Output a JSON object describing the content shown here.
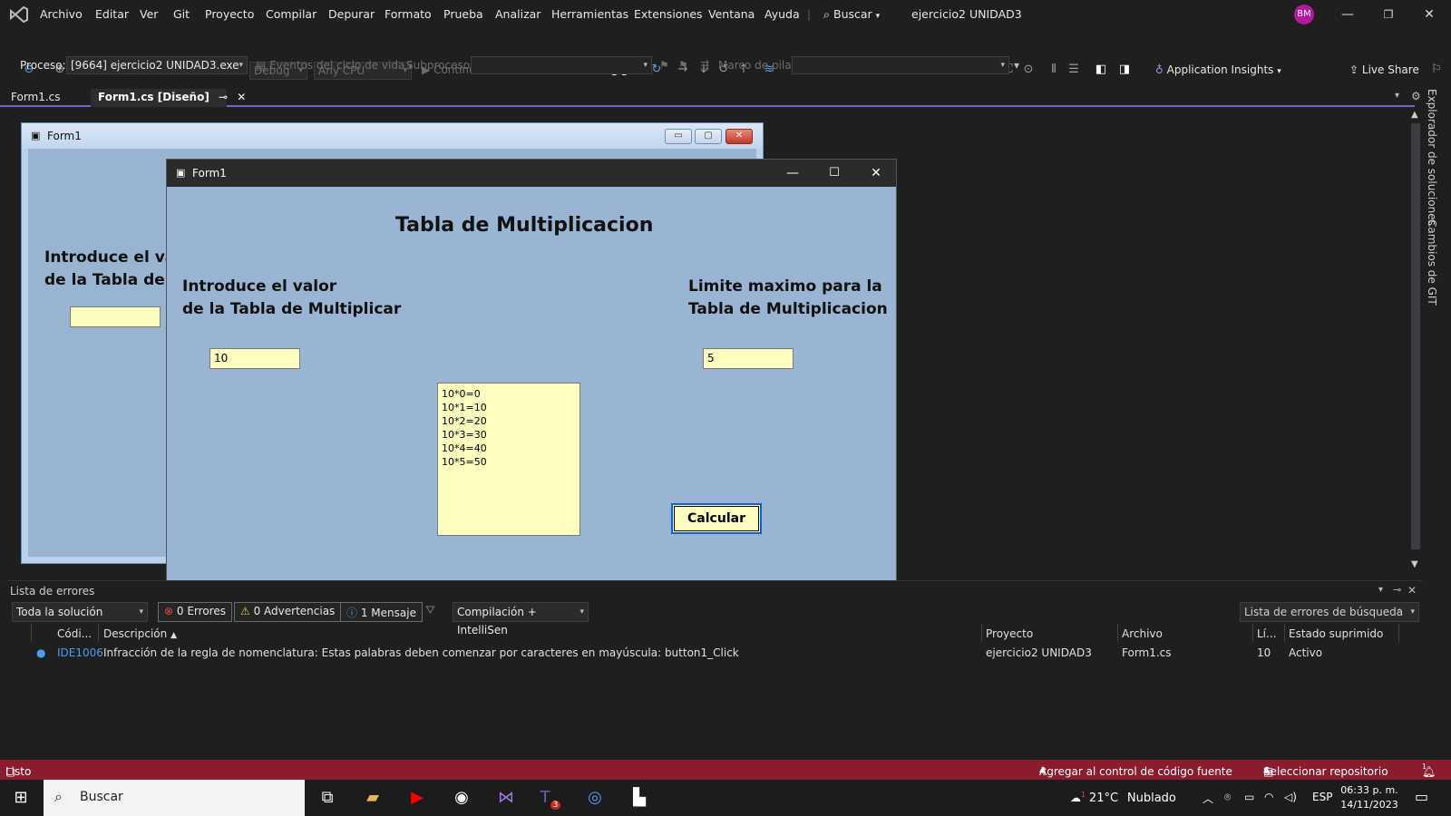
{
  "menubar": {
    "items": [
      "Archivo",
      "Editar",
      "Ver",
      "Git",
      "Proyecto",
      "Compilar",
      "Depurar",
      "Formato",
      "Prueba",
      "Analizar",
      "Herramientas",
      "Extensiones",
      "Ventana",
      "Ayuda"
    ],
    "search_label": "Buscar",
    "window_title": "ejercicio2 UNIDAD3",
    "avatar_initials": "BM"
  },
  "toolbar": {
    "config": "Debug",
    "platform": "Any CPU",
    "continue_label": "Continuar",
    "app_insights": "Application Insights",
    "live_share": "Live Share"
  },
  "procbar": {
    "process_label": "Proceso:",
    "process_value": "[9664] ejercicio2 UNIDAD3.exe",
    "lifecycle_label": "Eventos del ciclo de vida",
    "thread_label": "Subproceso:",
    "stack_label": "Marco de pila:"
  },
  "doctabs": {
    "tab1": "Form1.cs",
    "tab2": "Form1.cs [Diseño]"
  },
  "side_tabs": {
    "solution_explorer": "Explorador de soluciones",
    "git_changes": "Cambios de GIT"
  },
  "design_form": {
    "title": "Form1",
    "label1": "Introduce el val\nde la Tabla de M"
  },
  "runtime_form": {
    "title": "Form1",
    "heading": "Tabla de Multiplicacion",
    "label_value": "Introduce el valor\nde la Tabla de Multiplicar",
    "label_limit": "Limite maximo para la\nTabla de Multiplicacion",
    "input_value": "10",
    "input_limit": "5",
    "results": [
      "10*0=0",
      "10*1=10",
      "10*2=20",
      "10*3=30",
      "10*4=40",
      "10*5=50"
    ],
    "button": "Calcular"
  },
  "error_list": {
    "title": "Lista de errores",
    "scope": "Toda la solución",
    "errors": "0 Errores",
    "warnings": "0 Advertencias",
    "messages": "1 Mensaje",
    "build_filter": "Compilación + IntelliSen",
    "search_placeholder": "Lista de errores de búsqueda",
    "columns": {
      "code": "Códi...",
      "description": "Descripción",
      "project": "Proyecto",
      "file": "Archivo",
      "line": "Lí...",
      "suppression": "Estado suprimido"
    },
    "rows": [
      {
        "code": "IDE1006",
        "description": "Infracción de la regla de nomenclatura: Estas palabras deben comenzar por caracteres en mayúscula: button1_Click",
        "project": "ejercicio2 UNIDAD3",
        "file": "Form1.cs",
        "line": "10",
        "suppression": "Activo"
      }
    ]
  },
  "statusbar": {
    "ready": "Listo",
    "source_control": "Agregar al control de código fuente",
    "repo": "Seleccionar repositorio",
    "notifications": "1"
  },
  "taskbar": {
    "search": "Buscar",
    "teams_badge": "3",
    "weather_temp": "21°C",
    "weather_desc": "Nublado",
    "weather_badge": "1",
    "lang": "ESP",
    "time": "06:33 p. m.",
    "date": "14/11/2023"
  },
  "colors": {
    "accent": "#7b61c9",
    "statusbar": "#8a1c30",
    "form_back": "#9ab5d3",
    "control_back": "#ffffc0",
    "button_border": "#0a64d6"
  }
}
